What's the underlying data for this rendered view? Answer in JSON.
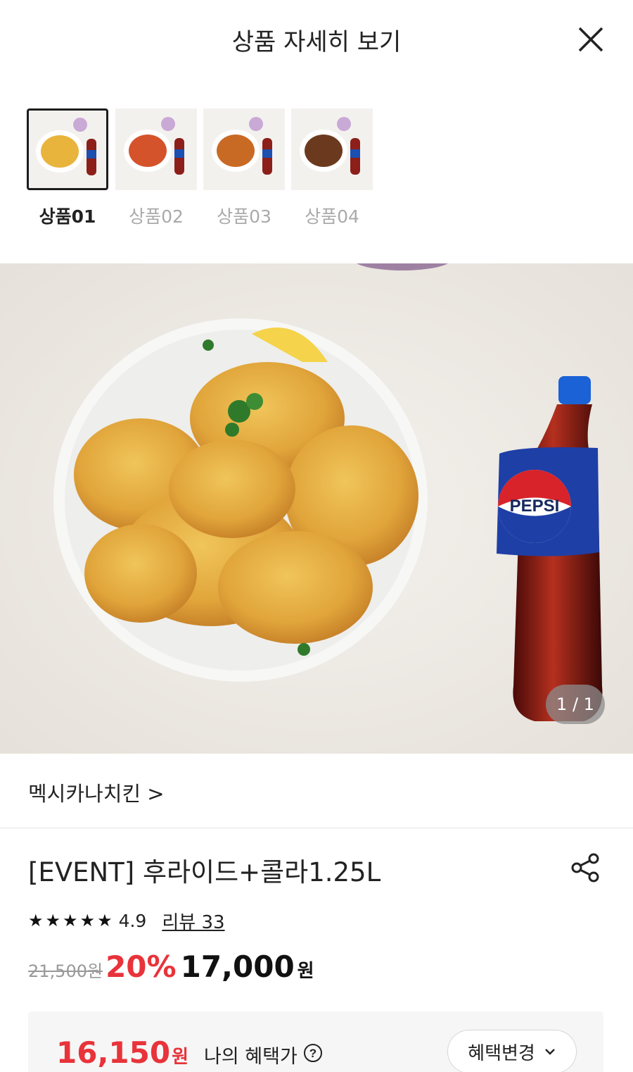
{
  "header": {
    "title": "상품 자세히 보기"
  },
  "thumbnails": [
    {
      "label": "상품01",
      "active": true,
      "chicken_color": "#e8b43c"
    },
    {
      "label": "상품02",
      "active": false,
      "chicken_color": "#d5532b"
    },
    {
      "label": "상품03",
      "active": false,
      "chicken_color": "#c96a24"
    },
    {
      "label": "상품04",
      "active": false,
      "chicken_color": "#6b3a1e"
    }
  ],
  "hero": {
    "counter": "1 / 1",
    "bottle_label": "PEPSI"
  },
  "brand": {
    "name": "멕시카나치킨 >"
  },
  "product": {
    "title": "[EVENT] 후라이드+콜라1.25L",
    "rating": "4.9",
    "star_count": 5,
    "review_label": "리뷰 33"
  },
  "price": {
    "original": "21,500원",
    "discount": "20%",
    "sale": "17,000",
    "sale_unit": "원"
  },
  "benefit": {
    "price": "16,150",
    "unit": "원",
    "label": "나의 혜택가",
    "button": "혜택변경"
  },
  "colors": {
    "accent": "#e8333a",
    "text": "#222222"
  }
}
